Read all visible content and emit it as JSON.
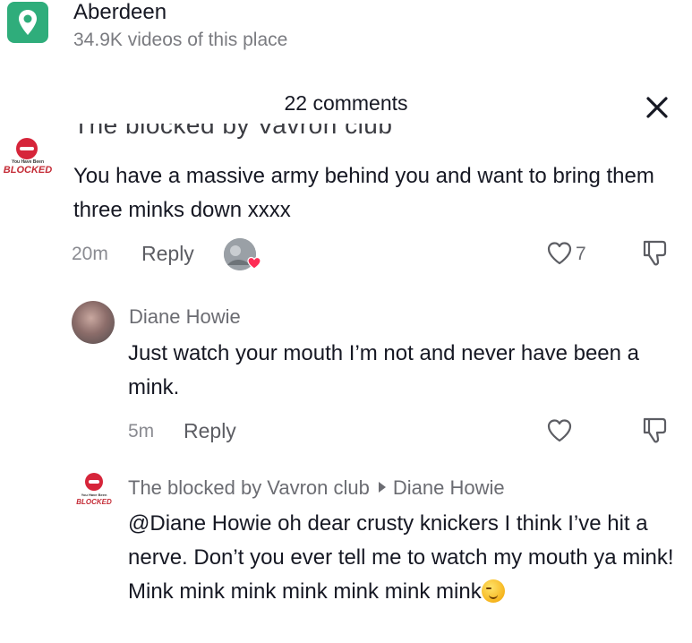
{
  "location": {
    "title": "Aberdeen",
    "subtitle": "34.9K videos of this place",
    "icon": "location-pin-icon",
    "icon_color": "#2fad7b"
  },
  "comments_panel": {
    "count_label": "22 comments",
    "close_icon": "close-icon"
  },
  "comment1": {
    "username_partial": "The blocked by Vavron club",
    "avatar_word": "BLOCKED",
    "avatar_small": "You Have Been",
    "text": "You have a massive army behind you and want to bring them three minks down xxxx",
    "time": "20m",
    "reply_label": "Reply",
    "like_count": "7"
  },
  "reply1": {
    "username": "Diane Howie",
    "text": "Just watch your mouth I’m not and never have been a mink.",
    "time": "5m",
    "reply_label": "Reply"
  },
  "reply2": {
    "username": "The blocked by Vavron club",
    "reply_to": "Diane Howie",
    "avatar_word": "BLOCKED",
    "avatar_small": "You Have Been",
    "mention": "@Diane Howie",
    "text": " oh dear crusty knickers I think I’ve hit a nerve. Don’t you ever tell me to watch my mouth ya mink! Mink mink mink mink mink mink mink",
    "emoji": "smirk-emoji"
  },
  "colors": {
    "accent_red": "#d6253a",
    "text_primary": "#161823",
    "text_secondary": "#8a8b91"
  }
}
